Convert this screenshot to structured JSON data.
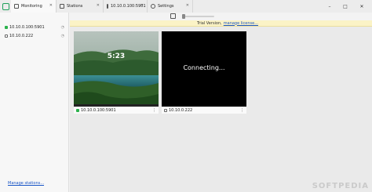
{
  "tabs": [
    {
      "label": "Monitoring",
      "icon": "monitor-icon",
      "active": true
    },
    {
      "label": "Stations",
      "icon": "stations-icon",
      "active": false
    },
    {
      "label": "10.10.0.100:5901",
      "icon": "screen-icon",
      "active": false
    },
    {
      "label": "Settings",
      "icon": "gear-icon",
      "active": false
    }
  ],
  "window_controls": {
    "minimize": "–",
    "maximize": "□",
    "close": "✕"
  },
  "sidebar": {
    "stations": [
      {
        "label": "10.10.0.100:5901",
        "status": "online"
      },
      {
        "label": "10.10.0.222",
        "status": "offline"
      }
    ],
    "manage_link": "Manage stations..."
  },
  "banner": {
    "text": "Trial Version,",
    "link": "manage license..."
  },
  "tiles": [
    {
      "label": "10.10.0.100:5901",
      "status": "online",
      "screen_text": "5:23",
      "menu": "⋮"
    },
    {
      "label": "10.10.0.222",
      "status": "offline",
      "screen_text": "Connecting...",
      "menu": "⋮"
    }
  ],
  "watermark": "SOFTPEDIA",
  "colors": {
    "online": "#2bb24c",
    "link": "#1a56c7",
    "banner_bg": "#fbf3c6"
  }
}
